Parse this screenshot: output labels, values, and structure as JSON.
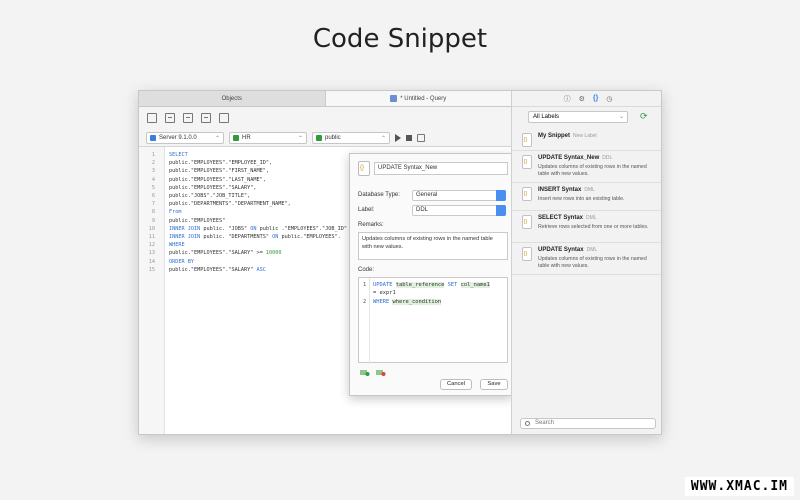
{
  "page_title": "Code Snippet",
  "tabs": [
    "Objects",
    "* Untitled - Query"
  ],
  "connection": {
    "server": "Server 9.1.0.0",
    "database": "HR",
    "schema": "public"
  },
  "editor": {
    "lines": [
      {
        "n": "1",
        "parts": [
          {
            "t": "SELECT",
            "c": "kw"
          }
        ]
      },
      {
        "n": "2",
        "parts": [
          {
            "t": "public.\"EMPLOYEES\".\"EMPLOYEE_ID\","
          }
        ]
      },
      {
        "n": "3",
        "parts": [
          {
            "t": "public.\"EMPLOYEES\".\"FIRST_NAME\","
          }
        ]
      },
      {
        "n": "4",
        "parts": [
          {
            "t": "public.\"EMPLOYEES\".\"LAST_NAME\","
          }
        ]
      },
      {
        "n": "5",
        "parts": [
          {
            "t": "public.\"EMPLOYEES\".\"SALARY\","
          }
        ]
      },
      {
        "n": "6",
        "parts": [
          {
            "t": "public.\"JOBS\".\"JOB_TITLE\","
          }
        ]
      },
      {
        "n": "7",
        "parts": [
          {
            "t": "public.\"DEPARTMENTS\".\"DEPARTMENT_NAME\","
          }
        ]
      },
      {
        "n": "8",
        "parts": [
          {
            "t": "From",
            "c": "kw"
          }
        ]
      },
      {
        "n": "9",
        "parts": [
          {
            "t": "public.\"EMPLOYEES\""
          }
        ]
      },
      {
        "n": "10",
        "parts": [
          {
            "t": "INNER JOIN",
            "c": "kw"
          },
          {
            "t": " public. \"JOBS\" "
          },
          {
            "t": "ON",
            "c": "kw"
          },
          {
            "t": " public .\"EMPLOYEES\".\"JOB_ID\" = p"
          }
        ]
      },
      {
        "n": "11",
        "parts": [
          {
            "t": "INNER JOIN",
            "c": "kw"
          },
          {
            "t": " public. \"DEPARTMENTS\" "
          },
          {
            "t": "ON",
            "c": "kw"
          },
          {
            "t": " public.\"EMPLOYEES\"."
          }
        ]
      },
      {
        "n": "12",
        "parts": [
          {
            "t": "WHERE",
            "c": "kw"
          }
        ]
      },
      {
        "n": "13",
        "parts": [
          {
            "t": "public.\"EMPLOYEES\".\"SALARY\" >= "
          },
          {
            "t": "10000",
            "c": "num"
          }
        ]
      },
      {
        "n": "14",
        "parts": [
          {
            "t": "ORDER BY",
            "c": "kw"
          }
        ]
      },
      {
        "n": "15",
        "parts": [
          {
            "t": "public.\"EMPLOYEES\".\"SALARY\" "
          },
          {
            "t": "ASC",
            "c": "kw"
          }
        ]
      }
    ]
  },
  "popover": {
    "name": "UPDATE Syntax_New",
    "db_type_label": "Database Type:",
    "db_type": "General",
    "label_label": "Label:",
    "label": "DDL",
    "remarks_label": "Remarks:",
    "remarks": "Updates columns of existing rows in the named table with new values.",
    "code_label": "Code:",
    "code_line1_kw1": "UPDATE",
    "code_line1_p1": "table_reference",
    "code_line1_kw2": "SET",
    "code_line1_p2": "col_name1",
    "code_line1_cont": "= expr1",
    "code_line2_kw": "WHERE",
    "code_line2_p": "where_condition",
    "cancel": "Cancel",
    "save": "Save"
  },
  "right_panel": {
    "filter": "All Labels",
    "search_placeholder": "Search",
    "snippets": [
      {
        "name": "My Snippet",
        "tag": "New Label",
        "desc": ""
      },
      {
        "name": "UPDATE Syntax_New",
        "tag": "DDL",
        "desc": "Updates columns of existing rows in the named table with new values."
      },
      {
        "name": "INSERT Syntax",
        "tag": "DML",
        "desc": "Insert new rows into an existing table."
      },
      {
        "name": "SELECT Syntax",
        "tag": "DML",
        "desc": "Retrieve rows selected from one or more tables."
      },
      {
        "name": "UPDATE Syntax",
        "tag": "DML",
        "desc": "Updates columns of existing rows in the named table with new values."
      }
    ]
  },
  "watermark": "WWW.XMAC.IM",
  "colors": {
    "accent": "#3b7de0",
    "keyword": "#2f6fd3",
    "number": "#2e9b3f",
    "highlight": "#dff0dc"
  }
}
